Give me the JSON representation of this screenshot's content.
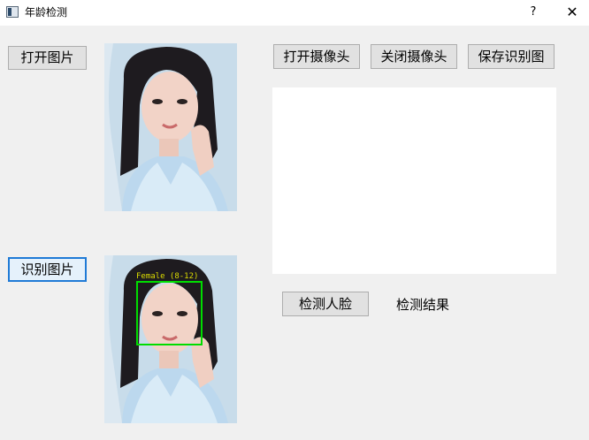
{
  "window": {
    "title": "年龄检测",
    "help_glyph": "?",
    "close_glyph": "✕"
  },
  "buttons": {
    "open_image": "打开图片",
    "recognize_image": "识别图片",
    "open_camera": "打开摄像头",
    "close_camera": "关闭摄像头",
    "save_result": "保存识别图",
    "detect_face": "检测人脸"
  },
  "result": {
    "label": "检测结果",
    "face_label": "Female (8-12)"
  },
  "colors": {
    "face_box": "#00dd00",
    "face_label": "#dddd00",
    "focus_border": "#1f7ad6"
  }
}
